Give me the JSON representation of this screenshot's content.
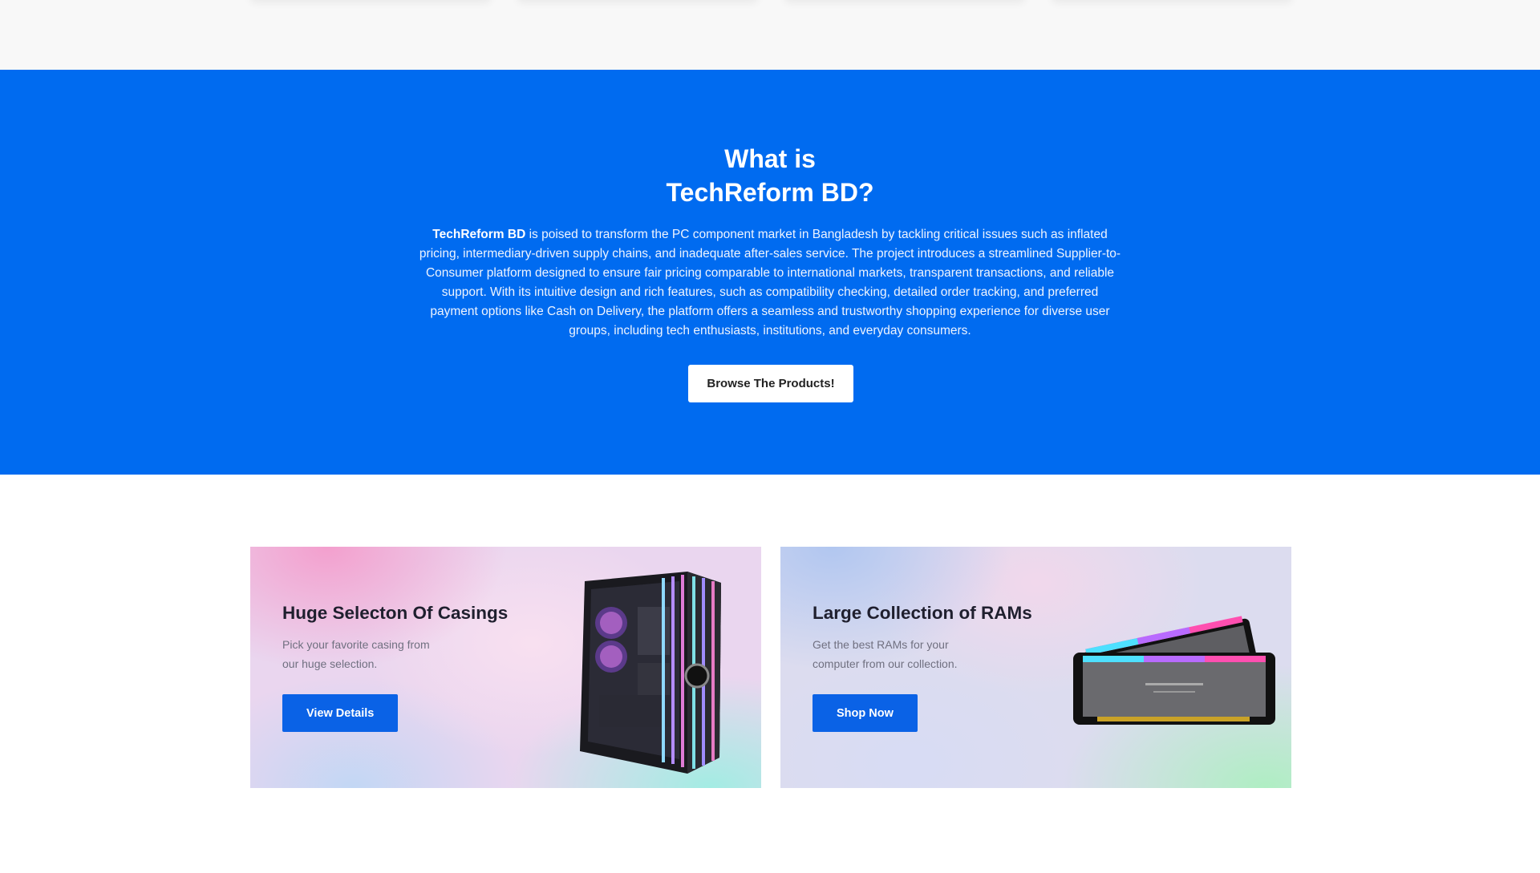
{
  "about": {
    "title_line1": "What is",
    "title_line2": "TechReform BD?",
    "brand_bold": "TechReform BD",
    "description": " is poised to transform the PC component market in Bangladesh by tackling critical issues such as inflated pricing, intermediary-driven supply chains, and inadequate after-sales service. The project introduces a streamlined Supplier-to-Consumer platform designed to ensure fair pricing comparable to international markets, transparent transactions, and reliable support. With its intuitive design and rich features, such as compatibility checking, detailed order tracking, and preferred payment options like Cash on Delivery, the platform offers a seamless and trustworthy shopping experience for diverse user groups, including tech enthusiasts, institutions, and everyday consumers.",
    "button_label": "Browse The Products!"
  },
  "promos": [
    {
      "title": "Huge Selecton Of Casings",
      "text": "Pick your favorite casing from our huge selection.",
      "button_label": "View Details",
      "image": "pc-casing-image"
    },
    {
      "title": "Large Collection of RAMs",
      "text": "Get the best RAMs for your computer from our collection.",
      "button_label": "Shop Now",
      "image": "ram-modules-image"
    }
  ],
  "colors": {
    "section_blue": "#006bf0",
    "button_blue": "#0a62e6",
    "page_bg": "#f8f8f8"
  }
}
